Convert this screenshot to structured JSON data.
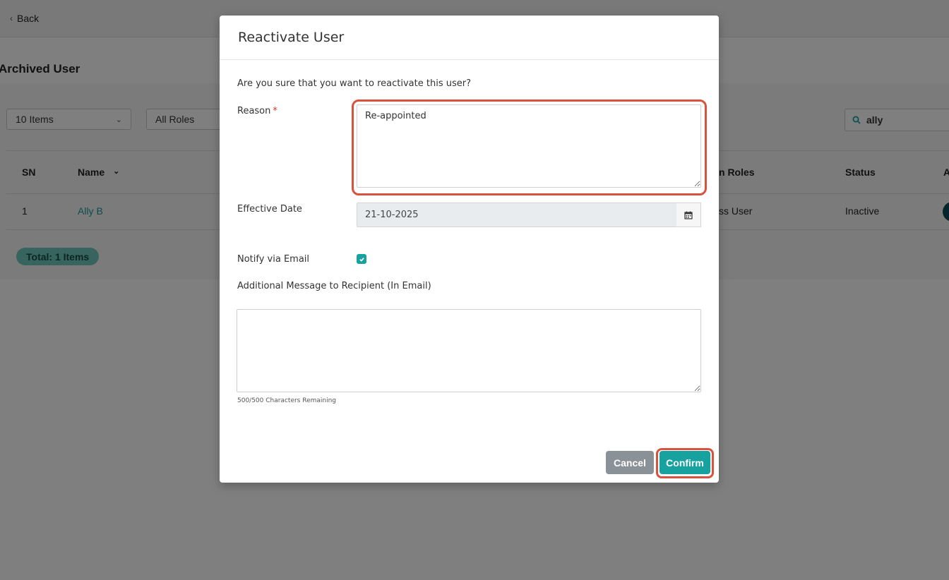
{
  "page": {
    "back_label": "Back",
    "title": "Archived User",
    "items_select": "10 Items",
    "roles_select": "All Roles",
    "search_value": "ally",
    "table": {
      "headers": [
        "SN",
        "Name",
        "n Roles",
        "Status",
        "A"
      ],
      "row": {
        "sn": "1",
        "name": "Ally B",
        "roles": "ss User",
        "status": "Inactive"
      }
    },
    "total": "Total: 1 Items"
  },
  "modal": {
    "title": "Reactivate User",
    "question": "Are you sure that you want to reactivate this user?",
    "reason_label": "Reason",
    "reason_required": "*",
    "reason_value": "Re-appointed",
    "effective_date_label": "Effective Date",
    "effective_date_value": "21-10-2025",
    "notify_label": "Notify via Email",
    "notify_checked": true,
    "additional_message_label": "Additional Message to Recipient (In Email)",
    "additional_message_value": "",
    "char_remaining": "500/500 Characters Remaining",
    "cancel_label": "Cancel",
    "confirm_label": "Confirm"
  },
  "colors": {
    "accent": "#17a2a0",
    "highlight": "#d9523e",
    "cancel": "#8a9197",
    "link": "#1a9a95"
  }
}
